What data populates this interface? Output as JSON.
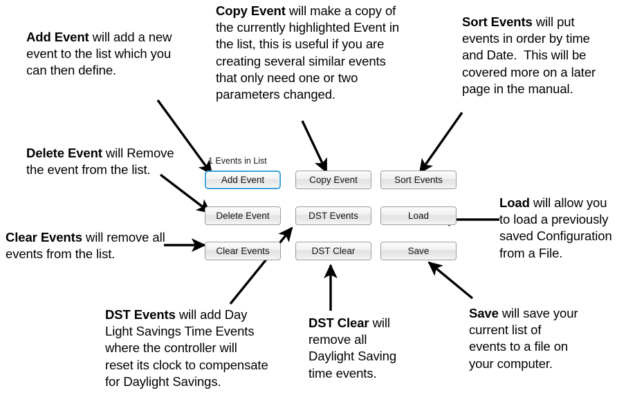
{
  "panel": {
    "events_label": "1 Events in List",
    "buttons": [
      {
        "id": "add-event",
        "label": "Add Event",
        "focused": true,
        "col": 1,
        "row": 1
      },
      {
        "id": "copy-event",
        "label": "Copy Event",
        "focused": false,
        "col": 2,
        "row": 1
      },
      {
        "id": "sort-events",
        "label": "Sort Events",
        "focused": false,
        "col": 3,
        "row": 1
      },
      {
        "id": "delete-event",
        "label": "Delete Event",
        "focused": false,
        "col": 1,
        "row": 2
      },
      {
        "id": "dst-events",
        "label": "DST Events",
        "focused": false,
        "col": 2,
        "row": 2
      },
      {
        "id": "load",
        "label": "Load",
        "focused": false,
        "col": 3,
        "row": 2
      },
      {
        "id": "clear-events",
        "label": "Clear Events",
        "focused": false,
        "col": 1,
        "row": 3
      },
      {
        "id": "dst-clear",
        "label": "DST Clear",
        "focused": false,
        "col": 2,
        "row": 3
      },
      {
        "id": "save",
        "label": "Save",
        "focused": false,
        "col": 3,
        "row": 3
      }
    ]
  },
  "annotations": {
    "add_event": {
      "term": "Add Event",
      "text": " will add a new event to the list which you can then define."
    },
    "copy_event": {
      "term": "Copy Event",
      "text": " will make a copy of the currently highlighted Event in the list, this is useful if you are creating several similar events that only need one or two parameters changed."
    },
    "sort_events": {
      "term": "Sort Events",
      "text": " will put events in order by time and Date.  This will be covered more on a later page in the manual."
    },
    "delete_event": {
      "term": "Delete Event",
      "text": " will Remove the event from the list."
    },
    "clear_events": {
      "term": "Clear Events",
      "text": " will remove all events from the list."
    },
    "load": {
      "term": "Load",
      "text": " will allow you to load a previously saved Configuration from a File."
    },
    "dst_events": {
      "term": "DST Events",
      "text": " will add Day Light Savings Time Events where the controller will reset its clock to compensate for Daylight Savings."
    },
    "dst_clear": {
      "term": "DST Clear",
      "text": " will remove all Daylight Saving time events."
    },
    "save": {
      "term": "Save",
      "text": " will save your current list of events to a file on your computer."
    }
  },
  "colors": {
    "focus_border": "#3c9fdc",
    "button_border": "#9a9a9a",
    "arrow": "#000000",
    "text": "#000000",
    "background": "#ffffff"
  }
}
